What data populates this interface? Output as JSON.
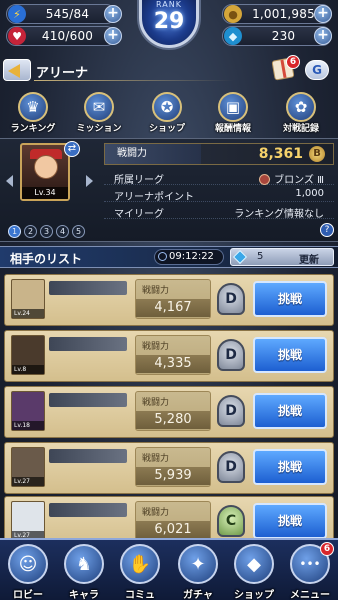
{
  "status": {
    "stamina": "545/84",
    "hp": "410/600",
    "rank_label": "RANK",
    "rank_value": "29",
    "gold": "1,001,985",
    "gems": "230"
  },
  "header": {
    "title": "アリーナ",
    "gift_badge": "6",
    "g_button": "G"
  },
  "menu": [
    {
      "label": "ランキング",
      "icon": "crown-icon",
      "glyph": "♛"
    },
    {
      "label": "ミッション",
      "icon": "scroll-icon",
      "glyph": "✉"
    },
    {
      "label": "ショップ",
      "icon": "coin-icon",
      "glyph": "✪"
    },
    {
      "label": "報酬情報",
      "icon": "chest-icon",
      "glyph": "▣"
    },
    {
      "label": "対戦記録",
      "icon": "laurel-icon",
      "glyph": "✿"
    }
  ],
  "player": {
    "level": "Lv.34",
    "decks": [
      "1",
      "2",
      "3",
      "4",
      "5"
    ],
    "power_label": "戦闘力",
    "power_value": "8,361",
    "league_label": "所属リーグ",
    "league_value": "ブロンズ Ⅲ",
    "points_label": "アリーナポイント",
    "points_value": "1,000",
    "my_league_label": "マイリーグ",
    "my_league_value": "ランキング情報なし",
    "help": "?"
  },
  "opponents_header": {
    "title": "相手のリスト",
    "timer": "09:12:22",
    "refresh_cost": "5",
    "refresh_label": "更新"
  },
  "opponents": [
    {
      "level": "Lv.24",
      "power_label": "戦闘力",
      "power": "4,167",
      "league": "D",
      "button": "挑戦",
      "avatar_color": "#c9b48a"
    },
    {
      "level": "Lv.8",
      "power_label": "戦闘力",
      "power": "4,335",
      "league": "D",
      "button": "挑戦",
      "avatar_color": "#4a3a2c"
    },
    {
      "level": "Lv.18",
      "power_label": "戦闘力",
      "power": "5,280",
      "league": "D",
      "button": "挑戦",
      "avatar_color": "#5a3a6a"
    },
    {
      "level": "Lv.27",
      "power_label": "戦闘力",
      "power": "5,939",
      "league": "D",
      "button": "挑戦",
      "avatar_color": "#6a5a4a"
    },
    {
      "level": "Lv.27",
      "power_label": "戦闘力",
      "power": "6,021",
      "league": "C",
      "button": "挑戦",
      "avatar_color": "#dfe4ea"
    }
  ],
  "nav": [
    {
      "label": "ロビー",
      "icon": "lobby-icon",
      "glyph": "☺"
    },
    {
      "label": "キャラ",
      "icon": "character-icon",
      "glyph": "♞"
    },
    {
      "label": "コミュ",
      "icon": "handshake-icon",
      "glyph": "✋"
    },
    {
      "label": "ガチャ",
      "icon": "gacha-icon",
      "glyph": "✦"
    },
    {
      "label": "ショップ",
      "icon": "shop-icon",
      "glyph": "◆"
    },
    {
      "label": "メニュー",
      "icon": "menu-icon",
      "glyph": "•••",
      "badge": "6"
    }
  ]
}
